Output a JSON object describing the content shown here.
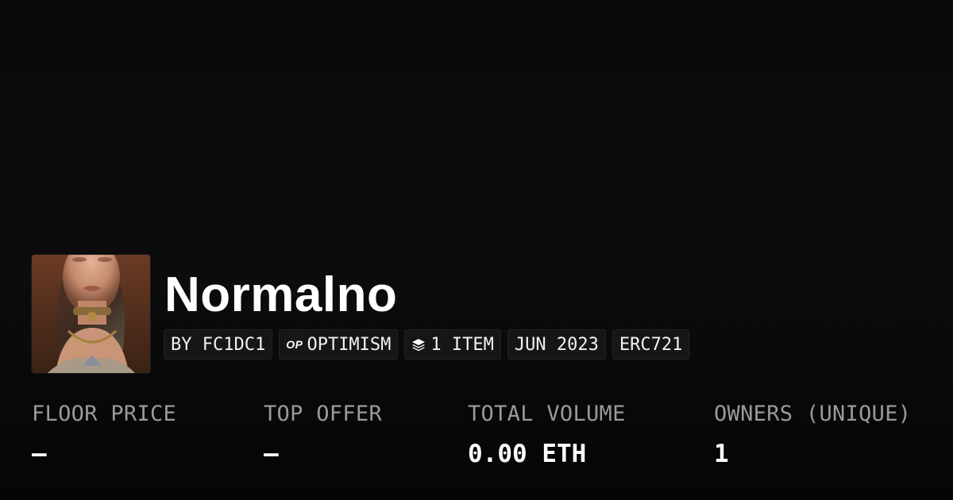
{
  "collection": {
    "name": "Normalno",
    "avatar_alt": "collection-avatar",
    "badges": [
      {
        "text": "BY FC1DC1",
        "icon": ""
      },
      {
        "text": "OPTIMISM",
        "icon": "op-logo-icon",
        "icon_text": "OP"
      },
      {
        "text": "1 ITEM",
        "icon": "layers-icon"
      },
      {
        "text": "JUN 2023",
        "icon": ""
      },
      {
        "text": "ERC721",
        "icon": ""
      }
    ]
  },
  "stats": [
    {
      "label": "FLOOR PRICE",
      "value": "—"
    },
    {
      "label": "TOP OFFER",
      "value": "—"
    },
    {
      "label": "TOTAL VOLUME",
      "value": "0.00 ETH"
    },
    {
      "label": "OWNERS (UNIQUE)",
      "value": "1"
    }
  ],
  "colors": {
    "background": "#0a0a0a",
    "badge_bg": "#161616",
    "label": "#9a9a9a",
    "value": "#ffffff"
  }
}
